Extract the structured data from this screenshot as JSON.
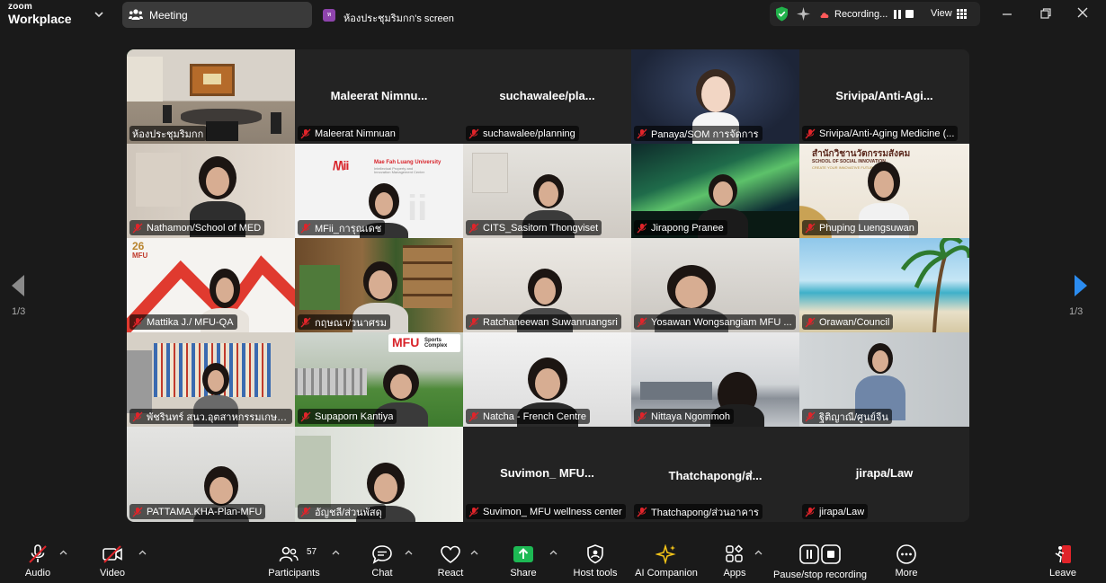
{
  "app": {
    "brand_top": "zoom",
    "brand_bottom": "Workplace"
  },
  "tabs": {
    "meeting": "Meeting",
    "screen": "ห้องประชุมริมกก's screen",
    "screen_avatar": "ห"
  },
  "status": {
    "recording": "Recording...",
    "view": "View"
  },
  "pagination": {
    "left": "1/3",
    "right": "1/3"
  },
  "participants": [
    {
      "name": "ห้องประชุมริมกก",
      "center": ""
    },
    {
      "name": "Maleerat Nimnuan",
      "center": "Maleerat  Nimnu..."
    },
    {
      "name": "suchawalee/planning",
      "center": "suchawalee/pla..."
    },
    {
      "name": "Panaya/SOM การจัดการ",
      "center": ""
    },
    {
      "name": "Srivipa/Anti-Aging Medicine (...",
      "center": "Srivipa/Anti-Agi..."
    },
    {
      "name": "Nathamon/School of MED",
      "center": ""
    },
    {
      "name": "MFii_การุณเดช",
      "center": ""
    },
    {
      "name": "CITS_Sasitorn Thongviset",
      "center": ""
    },
    {
      "name": "Jirapong Pranee",
      "center": ""
    },
    {
      "name": "Phuping Luengsuwan",
      "center": ""
    },
    {
      "name": "Mattika J./ MFU-QA",
      "center": ""
    },
    {
      "name": "กฤษณา/วนาศรม",
      "center": ""
    },
    {
      "name": "Ratchaneewan Suwanruangsri",
      "center": ""
    },
    {
      "name": "Yosawan Wongsangiam MFU ...",
      "center": ""
    },
    {
      "name": "Orawan/Council",
      "center": ""
    },
    {
      "name": "พัชรินทร์ สนว.อุตสาหกรรมเกษตร",
      "center": ""
    },
    {
      "name": "Supaporn Kantiya",
      "center": ""
    },
    {
      "name": "Natcha - French Centre",
      "center": ""
    },
    {
      "name": "Nittaya Ngommoh",
      "center": ""
    },
    {
      "name": "ฐิติญาณี/ศูนย์จีน",
      "center": ""
    },
    {
      "name": "PATTAMA.KHA-Plan-MFU",
      "center": ""
    },
    {
      "name": "อัญชลี/ส่วนพัสดุ",
      "center": ""
    },
    {
      "name": "Suvimon_ MFU wellness center",
      "center": "Suvimon_  MFU..."
    },
    {
      "name": "Thatchapong/ส่วนอาคาร",
      "center": "Thatchapong/ส่..."
    },
    {
      "name": "jirapa/Law",
      "center": "jirapa/Law"
    }
  ],
  "tile_text": {
    "mfii_logo": "Mae Fah Luang University",
    "mfii_sub": "Intellectual Property and Innovation Management Center",
    "soc_th": "สำนักวิชานวัตกรรมสังคม",
    "soc_en": "SCHOOL OF SOCIAL INNOVATION",
    "soc_tag": "CREATE YOUR INNOVATIVE FUTURE",
    "mfu26": "26",
    "mfu_label": "MFU",
    "mfu_sports": "MFU",
    "sports_word": "Sports Complex"
  },
  "toolbar": {
    "audio": "Audio",
    "video": "Video",
    "participants": "Participants",
    "participant_count": "57",
    "chat": "Chat",
    "react": "React",
    "share": "Share",
    "host_tools": "Host tools",
    "ai_companion": "AI Companion",
    "apps": "Apps",
    "pause_recording": "Pause/stop recording",
    "more": "More",
    "leave": "Leave"
  },
  "colors": {
    "active_border": "#3fd06a",
    "share_green": "#1db954",
    "leave_red": "#e0242a",
    "muted_red": "#e0242a",
    "ai_yellow": "#f5c518"
  }
}
